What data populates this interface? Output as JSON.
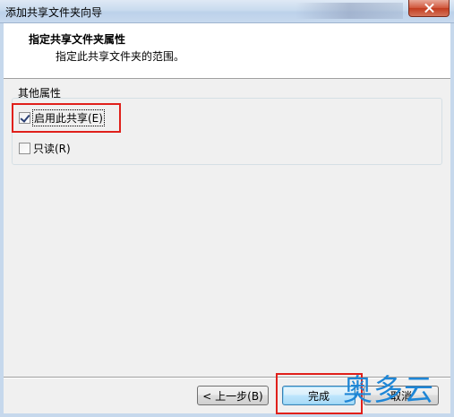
{
  "window": {
    "title": "添加共享文件夹向导"
  },
  "header": {
    "title": "指定共享文件夹属性",
    "subtitle": "指定此共享文件夹的范围。"
  },
  "group": {
    "label": "其他属性",
    "options": [
      {
        "label": "启用此共享(E)",
        "checked": true
      },
      {
        "label": "只读(R)",
        "checked": false
      }
    ]
  },
  "buttons": {
    "back": "< 上一步(B)",
    "finish": "完成",
    "cancel": "取消"
  },
  "watermark": {
    "text_a": "奥",
    "text_b": "多云"
  },
  "colors": {
    "highlight": "#e0201b",
    "watermark": "#1e86d6"
  }
}
